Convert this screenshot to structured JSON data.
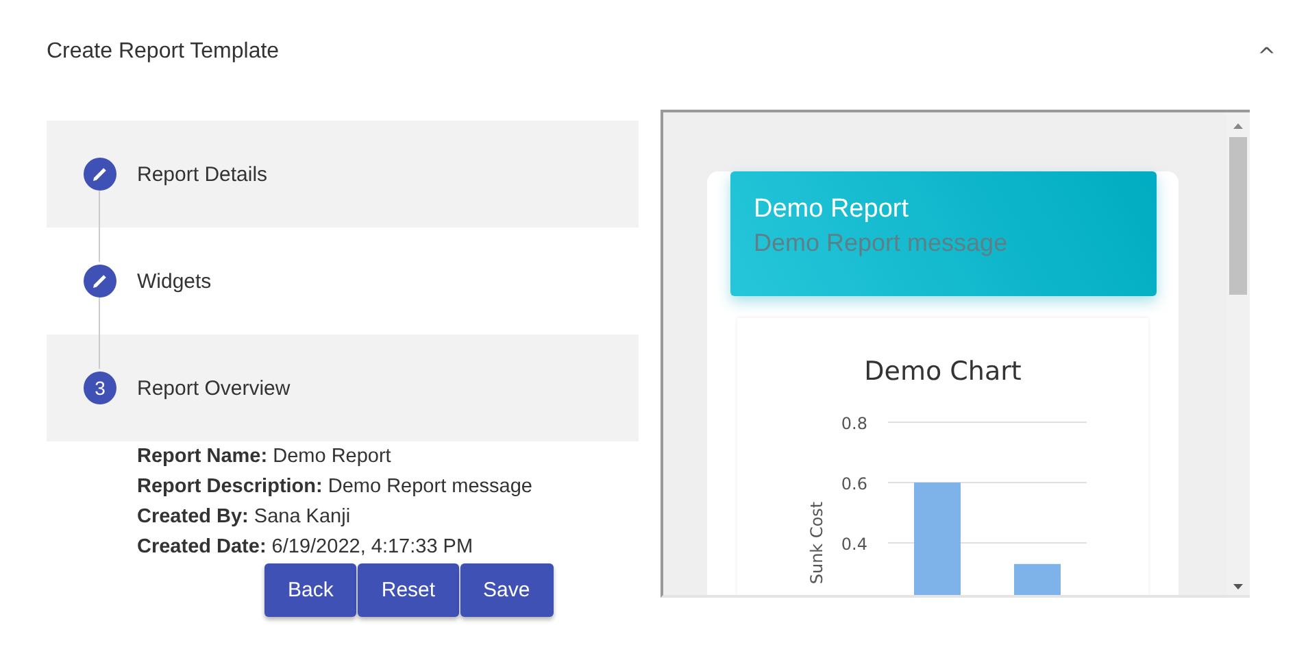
{
  "title": "Create Report Template",
  "collapse_icon": "^",
  "steps": [
    {
      "kind": "edit",
      "label": "Report Details",
      "highlighted": true
    },
    {
      "kind": "edit",
      "label": "Widgets",
      "highlighted": false
    },
    {
      "kind": "number",
      "number": "3",
      "label": "Report Overview",
      "highlighted": true
    }
  ],
  "overview": [
    "**Report Name:** Demo Report",
    "**Report Description:** Demo Report message",
    "**Created By:** Sana Kanji",
    "**Created Date:** 6/19/2022, 4:17:33 PM"
  ],
  "buttons": [
    "Back",
    "Reset",
    "Save"
  ],
  "preview": {
    "title": "Demo Report",
    "message": "Demo Report message",
    "chart_data": {
      "type": "bar",
      "title": "Demo Chart",
      "ylabel": "Sunk Cost",
      "ylim": [
        0.2,
        0.8
      ],
      "yticks": [
        0.4,
        0.6,
        0.8
      ],
      "values": [
        0.6,
        0.33
      ]
    }
  }
}
